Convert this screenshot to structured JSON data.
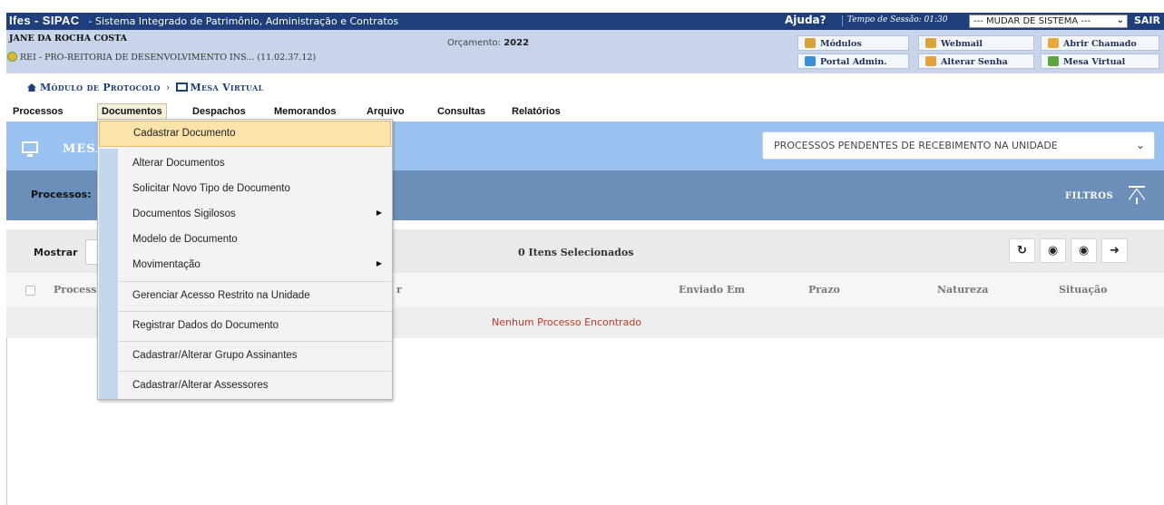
{
  "topbar": {
    "app": "Ifes - SIPAC",
    "subtitle": "- Sistema Integrado de Patrimônio, Administração e Contratos",
    "help": "Ajuda?",
    "session": "Tempo de Sessão: 01:30",
    "system_select": "--- MUDAR DE SISTEMA ---",
    "logout": "SAIR"
  },
  "info": {
    "user": "JANE DA ROCHA COSTA",
    "unit": "REI - PRO-REITORIA DE DESENVOLVIMENTO INS... (11.02.37.12)",
    "budget_label": "Orçamento:",
    "budget_year": "2022"
  },
  "quick": [
    {
      "label": "Módulos",
      "icon": "modules-icon",
      "color": "#d9a23a"
    },
    {
      "label": "Webmail",
      "icon": "webmail-icon",
      "color": "#d9a23a"
    },
    {
      "label": "Abrir Chamado",
      "icon": "ticket-icon",
      "color": "#e6a93a"
    },
    {
      "label": "Portal Admin.",
      "icon": "portal-admin-icon",
      "color": "#3a8fd9"
    },
    {
      "label": "Alterar Senha",
      "icon": "password-icon",
      "color": "#e1a23a"
    },
    {
      "label": "Mesa Virtual",
      "icon": "virtual-desk-icon",
      "color": "#5aa83a"
    }
  ],
  "breadcrumb": {
    "module": "Módulo de Protocolo",
    "page": "Mesa Virtual"
  },
  "menu": [
    "Processos",
    "Documentos",
    "Despachos",
    "Memorandos",
    "Arquivo",
    "Consultas",
    "Relatórios"
  ],
  "header": {
    "title": "MESA",
    "select": "PROCESSOS PENDENTES DE RECEBIMENTO NA UNIDADE"
  },
  "processes": {
    "label": "Processos:",
    "filters": "FILTROS"
  },
  "show": {
    "label": "Mostrar",
    "selected": "0 Itens Selecionados"
  },
  "table": {
    "columns": [
      "Process",
      "r",
      "Enviado Em",
      "Prazo",
      "Natureza",
      "Situação"
    ],
    "empty": "Nenhum Processo Encontrado"
  },
  "dropdown": [
    "Cadastrar Documento",
    "Alterar Documentos",
    "Solicitar Novo Tipo de Documento",
    "Documentos Sigilosos",
    "Modelo de Documento",
    "Movimentação",
    "Gerenciar Acesso Restrito na Unidade",
    "Registrar Dados do Documento",
    "Cadastrar/Alterar Grupo Assinantes",
    "Cadastrar/Alterar Assessores"
  ],
  "colors": {
    "nav": "#1f3e7c",
    "band": "#99c2f0",
    "procbar": "#6c8fb9",
    "highlight": "#fbe3a9",
    "error": "#c0392b"
  }
}
